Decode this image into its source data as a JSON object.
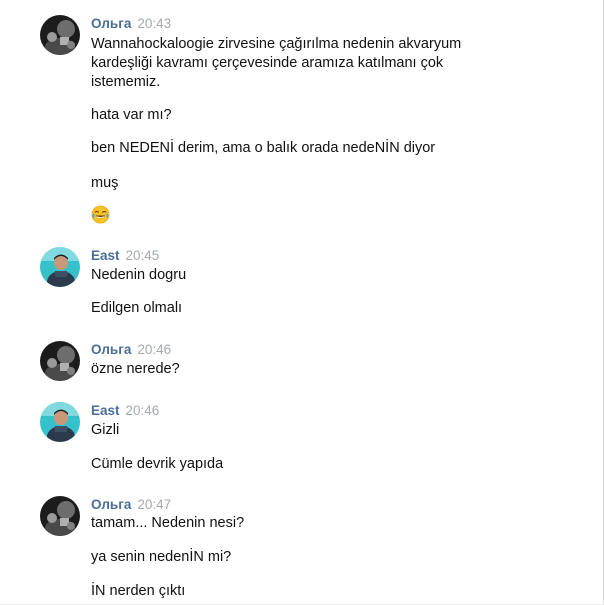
{
  "messages": [
    {
      "sender": "Ольга",
      "time": "20:43",
      "lines": [
        "Wannahockaloogie zirvesine çağırılma nedenin akvaryum",
        "kardeşliği kavramı çerçevesinde aramıza katılmanı çok",
        "istememiz.",
        "hata var mı?",
        "ben NEDENİ derim, ama o balık orada nedeNİN diyor",
        "muş"
      ],
      "emoji": "tears-of-joy-emoji"
    },
    {
      "sender": "East",
      "time": "20:45",
      "lines": [
        "Nedenin dogru",
        "Edilgen olmalı"
      ]
    },
    {
      "sender": "Ольга",
      "time": "20:46",
      "lines": [
        "özne nerede?"
      ]
    },
    {
      "sender": "East",
      "time": "20:46",
      "lines": [
        "Gizli",
        "Cümle devrik yapıda"
      ]
    },
    {
      "sender": "Ольга",
      "time": "20:47",
      "lines": [
        "tamam... Nedenin nesi?",
        "ya senin nedenİN mi?",
        "İN nerden çıktı"
      ]
    }
  ],
  "colors": {
    "sender": "#4a6e96",
    "time": "#a4a9ae",
    "text": "#111111"
  }
}
